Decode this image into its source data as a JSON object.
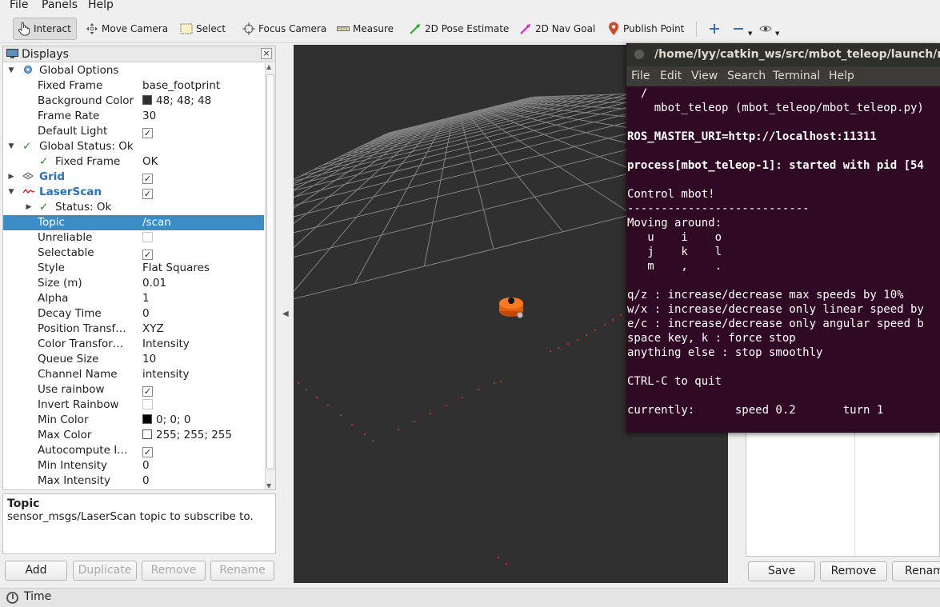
{
  "menubar": {
    "items": [
      "File",
      "Panels",
      "Help"
    ]
  },
  "toolbar": {
    "tools": [
      {
        "label": "Interact",
        "icon": "hand-pointer-icon"
      },
      {
        "label": "Move Camera",
        "icon": "move-camera-icon"
      },
      {
        "label": "Select",
        "icon": "select-rect-icon"
      },
      {
        "label": "Focus Camera",
        "icon": "focus-crosshair-icon"
      },
      {
        "label": "Measure",
        "icon": "ruler-icon"
      },
      {
        "label": "2D Pose Estimate",
        "icon": "green-arrow-icon"
      },
      {
        "label": "2D Nav Goal",
        "icon": "magenta-arrow-icon"
      },
      {
        "label": "Publish Point",
        "icon": "map-pin-icon"
      }
    ],
    "active_tool": "Interact"
  },
  "displays": {
    "title": "Displays",
    "rows": [
      {
        "name": "Global Options",
        "value": ""
      },
      {
        "name": "Fixed Frame",
        "value": "base_footprint"
      },
      {
        "name": "Background Color",
        "value": "48; 48; 48"
      },
      {
        "name": "Frame Rate",
        "value": "30"
      },
      {
        "name": "Default Light",
        "value": ""
      },
      {
        "name": "Global Status: Ok",
        "value": ""
      },
      {
        "name": "Fixed Frame",
        "value": "OK"
      },
      {
        "name": "Grid",
        "value": ""
      },
      {
        "name": "LaserScan",
        "value": ""
      },
      {
        "name": "Status: Ok",
        "value": ""
      },
      {
        "name": "Topic",
        "value": "/scan"
      },
      {
        "name": "Unreliable",
        "value": ""
      },
      {
        "name": "Selectable",
        "value": ""
      },
      {
        "name": "Style",
        "value": "Flat Squares"
      },
      {
        "name": "Size (m)",
        "value": "0.01"
      },
      {
        "name": "Alpha",
        "value": "1"
      },
      {
        "name": "Decay Time",
        "value": "0"
      },
      {
        "name": "Position Transf…",
        "value": "XYZ"
      },
      {
        "name": "Color Transfor…",
        "value": "Intensity"
      },
      {
        "name": "Queue Size",
        "value": "10"
      },
      {
        "name": "Channel Name",
        "value": "intensity"
      },
      {
        "name": "Use rainbow",
        "value": ""
      },
      {
        "name": "Invert Rainbow",
        "value": ""
      },
      {
        "name": "Min Color",
        "value": "0; 0; 0"
      },
      {
        "name": "Max Color",
        "value": "255; 255; 255"
      },
      {
        "name": "Autocompute I…",
        "value": ""
      },
      {
        "name": "Min Intensity",
        "value": "0"
      },
      {
        "name": "Max Intensity",
        "value": "0"
      }
    ],
    "colors": {
      "background": "#303030",
      "min_color": "#000000",
      "max_color": "#ffffff"
    }
  },
  "description": {
    "title": "Topic",
    "body": "sensor_msgs/LaserScan topic to subscribe to."
  },
  "left_buttons": [
    "Add",
    "Duplicate",
    "Remove",
    "Rename"
  ],
  "right_buttons": [
    "Save",
    "Remove",
    "Renam"
  ],
  "time_panel": {
    "label": "Time"
  },
  "terminal": {
    "title": "/home/lyy/catkin_ws/src/mbot_teleop/launch/mbo",
    "menu": [
      "File",
      "Edit",
      "View",
      "Search",
      "Terminal",
      "Help"
    ],
    "lines": [
      "  /",
      "    mbot_teleop (mbot_teleop/mbot_teleop.py)",
      "",
      "ROS_MASTER_URI=http://localhost:11311",
      "",
      "process[mbot_teleop-1]: started with pid [54",
      "",
      "Control mbot!",
      "---------------------------",
      "Moving around:",
      "   u    i    o",
      "   j    k    l",
      "   m    ,    .",
      "",
      "q/z : increase/decrease max speeds by 10%",
      "w/x : increase/decrease only linear speed by",
      "e/c : increase/decrease only angular speed b",
      "space key, k : force stop",
      "anything else : stop smoothly",
      "",
      "CTRL-C to quit",
      "",
      "currently:      speed 0.2       turn 1"
    ],
    "colors": {
      "background": "#300a24",
      "text": "#ffffff"
    }
  }
}
